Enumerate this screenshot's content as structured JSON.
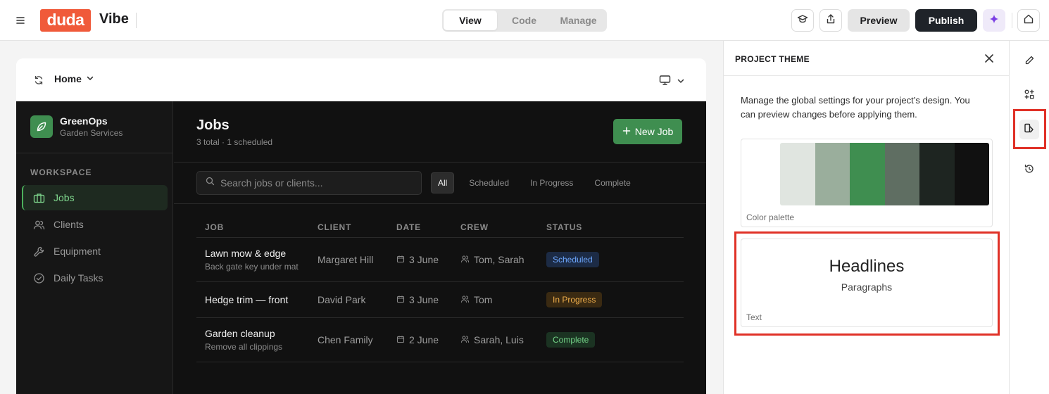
{
  "header": {
    "logo_text": "duda",
    "product_name": "Vibe",
    "tabs": [
      {
        "label": "View",
        "active": true
      },
      {
        "label": "Code",
        "active": false
      },
      {
        "label": "Manage",
        "active": false
      }
    ],
    "preview_label": "Preview",
    "publish_label": "Publish",
    "icons": [
      "menu-icon",
      "academy-icon",
      "share-icon",
      "ai-sparkle-icon",
      "home-icon"
    ]
  },
  "canvas": {
    "page_selector": "Home",
    "device": "desktop-icon"
  },
  "site": {
    "brand": {
      "name": "GreenOps",
      "subtitle": "Garden Services"
    },
    "workspace_label": "WORKSPACE",
    "nav": [
      {
        "label": "Jobs",
        "icon": "briefcase-icon",
        "active": true
      },
      {
        "label": "Clients",
        "icon": "users-icon",
        "active": false
      },
      {
        "label": "Equipment",
        "icon": "wrench-icon",
        "active": false
      },
      {
        "label": "Daily Tasks",
        "icon": "check-circle-icon",
        "active": false
      }
    ],
    "title": "Jobs",
    "summary": "3 total · 1 scheduled",
    "new_job_label": "New Job",
    "search_placeholder": "Search jobs or clients...",
    "filters": [
      {
        "label": "All",
        "active": true
      },
      {
        "label": "Scheduled",
        "active": false
      },
      {
        "label": "In Progress",
        "active": false
      },
      {
        "label": "Complete",
        "active": false
      }
    ],
    "columns": [
      "JOB",
      "CLIENT",
      "DATE",
      "CREW",
      "STATUS"
    ],
    "rows": [
      {
        "job": "Lawn mow & edge",
        "note": "Back gate key under mat",
        "client": "Margaret Hill",
        "date": "3 June",
        "crew": "Tom, Sarah",
        "status": "Scheduled",
        "status_fg": "#6ea8ff",
        "status_bg": "#1c2b45"
      },
      {
        "job": "Hedge trim — front",
        "note": "",
        "client": "David Park",
        "date": "3 June",
        "crew": "Tom",
        "status": "In Progress",
        "status_fg": "#f2b04c",
        "status_bg": "#3a2a12"
      },
      {
        "job": "Garden cleanup",
        "note": "Remove all clippings",
        "client": "Chen Family",
        "date": "2 June",
        "crew": "Sarah, Luis",
        "status": "Complete",
        "status_fg": "#74d488",
        "status_bg": "#1b3322"
      }
    ]
  },
  "theme_panel": {
    "title": "PROJECT THEME",
    "description": "Manage the global settings for your project’s design. You can preview changes before applying them.",
    "palette_label": "Color palette",
    "palette": [
      "#ffffff",
      "#e0e5e0",
      "#9aae9c",
      "#3f8e50",
      "#5f6e62",
      "#1e2521",
      "#111111"
    ],
    "text_card_label": "Text",
    "headline_sample": "Headlines",
    "paragraph_sample": "Paragraphs"
  },
  "rail": {
    "items": [
      {
        "icon": "edit-icon",
        "active": false
      },
      {
        "icon": "widgets-icon",
        "active": false
      },
      {
        "icon": "theme-icon",
        "active": true
      },
      {
        "icon": "history-icon",
        "active": false
      }
    ]
  },
  "colors": {
    "brand_orange": "#f05a3a",
    "publish_dark": "#1f2329",
    "site_green": "#3f8e50",
    "highlight_red": "#e03127"
  }
}
